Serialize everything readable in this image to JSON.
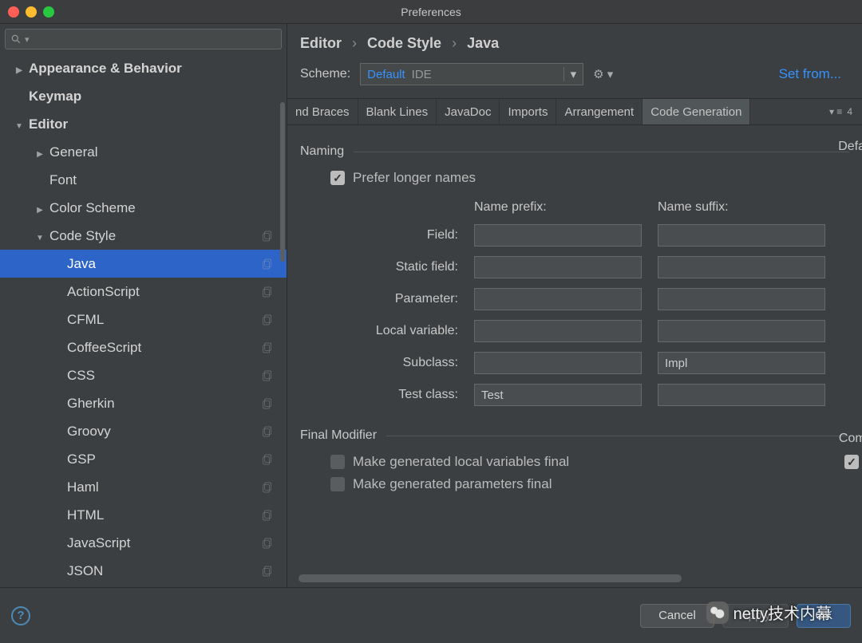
{
  "window": {
    "title": "Preferences"
  },
  "search": {
    "placeholder": ""
  },
  "sidebar": {
    "items": [
      {
        "label": "Appearance & Behavior",
        "indent": 0,
        "arrow": "closed",
        "bold": true
      },
      {
        "label": "Keymap",
        "indent": 0,
        "arrow": "none",
        "bold": true
      },
      {
        "label": "Editor",
        "indent": 0,
        "arrow": "open",
        "bold": true
      },
      {
        "label": "General",
        "indent": 1,
        "arrow": "closed"
      },
      {
        "label": "Font",
        "indent": 1,
        "arrow": "none"
      },
      {
        "label": "Color Scheme",
        "indent": 1,
        "arrow": "closed"
      },
      {
        "label": "Code Style",
        "indent": 1,
        "arrow": "open",
        "copy": true
      },
      {
        "label": "Java",
        "indent": 2,
        "arrow": "none",
        "selected": true,
        "copy": true
      },
      {
        "label": "ActionScript",
        "indent": 2,
        "arrow": "none",
        "copy": true
      },
      {
        "label": "CFML",
        "indent": 2,
        "arrow": "none",
        "copy": true
      },
      {
        "label": "CoffeeScript",
        "indent": 2,
        "arrow": "none",
        "copy": true
      },
      {
        "label": "CSS",
        "indent": 2,
        "arrow": "none",
        "copy": true
      },
      {
        "label": "Gherkin",
        "indent": 2,
        "arrow": "none",
        "copy": true
      },
      {
        "label": "Groovy",
        "indent": 2,
        "arrow": "none",
        "copy": true
      },
      {
        "label": "GSP",
        "indent": 2,
        "arrow": "none",
        "copy": true
      },
      {
        "label": "Haml",
        "indent": 2,
        "arrow": "none",
        "copy": true
      },
      {
        "label": "HTML",
        "indent": 2,
        "arrow": "none",
        "copy": true
      },
      {
        "label": "JavaScript",
        "indent": 2,
        "arrow": "none",
        "copy": true
      },
      {
        "label": "JSON",
        "indent": 2,
        "arrow": "none",
        "copy": true
      }
    ]
  },
  "breadcrumb": {
    "a": "Editor",
    "b": "Code Style",
    "c": "Java"
  },
  "scheme": {
    "label": "Scheme:",
    "value": "Default",
    "badge": "IDE"
  },
  "setfrom": "Set from...",
  "tabs": [
    {
      "label": "nd Braces"
    },
    {
      "label": "Blank Lines"
    },
    {
      "label": "JavaDoc"
    },
    {
      "label": "Imports"
    },
    {
      "label": "Arrangement"
    },
    {
      "label": "Code Generation",
      "active": true
    }
  ],
  "tabs_right": "4",
  "rightcut": {
    "def": "Defa",
    "comm": "Comm"
  },
  "naming": {
    "header": "Naming",
    "prefer_longer": {
      "label": "Prefer longer names",
      "checked": true
    },
    "col_prefix": "Name prefix:",
    "col_suffix": "Name suffix:",
    "rows": [
      {
        "label": "Field:",
        "prefix": "",
        "suffix": ""
      },
      {
        "label": "Static field:",
        "prefix": "",
        "suffix": ""
      },
      {
        "label": "Parameter:",
        "prefix": "",
        "suffix": ""
      },
      {
        "label": "Local variable:",
        "prefix": "",
        "suffix": ""
      },
      {
        "label": "Subclass:",
        "prefix": "",
        "suffix": "Impl"
      },
      {
        "label": "Test class:",
        "prefix": "Test",
        "suffix": ""
      }
    ]
  },
  "final_mod": {
    "header": "Final Modifier",
    "opt1": "Make generated local variables final",
    "opt2": "Make generated parameters final",
    "opt2_right_checked": true
  },
  "footer": {
    "cancel": "Cancel",
    "apply": "Apply",
    "ok": "OK"
  },
  "watermark": "netty技术内幕"
}
